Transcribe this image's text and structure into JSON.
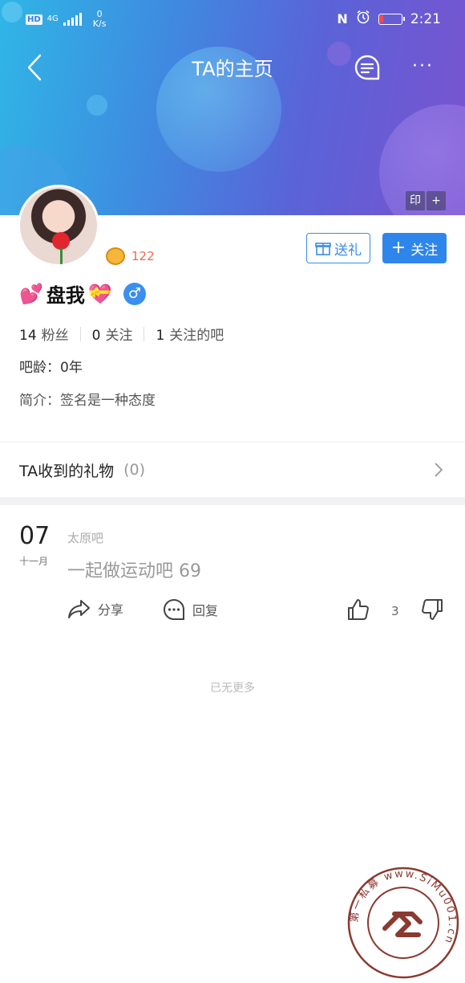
{
  "status_bar": {
    "hd": "HD",
    "network": "4G",
    "speed_value": "0",
    "speed_unit": "K/s",
    "nfc": "N",
    "time": "2:21"
  },
  "nav": {
    "title": "TA的主页",
    "more": "···"
  },
  "banner_tools": {
    "stamp": "印",
    "add": "+"
  },
  "profile": {
    "level": "122",
    "gift_button": "送礼",
    "follow_button": "关注",
    "follow_plus": "+",
    "username": "盘我",
    "gender_symbol": "♂",
    "fans_count": "14",
    "fans_label": "粉丝",
    "following_count": "0",
    "following_label": "关注",
    "bars_count": "1",
    "bars_label": "关注的吧",
    "age": "吧龄：0年",
    "bio": "简介：签名是一种态度"
  },
  "gifts": {
    "label": "TA收到的礼物",
    "count": "(0)"
  },
  "post": {
    "day": "07",
    "month": "十一月",
    "forum": "太原吧",
    "title": "一起做运动吧 69",
    "share_label": "分享",
    "reply_label": "回复",
    "like_count": "3"
  },
  "footer": {
    "no_more": "已无更多"
  },
  "watermark": {
    "text": "第一私募 www.SiMu001.cn"
  },
  "colors": {
    "accent": "#2f86ea",
    "level": "#f06a4a",
    "banner_start": "#2fb6e6",
    "banner_end": "#7a53cf"
  }
}
